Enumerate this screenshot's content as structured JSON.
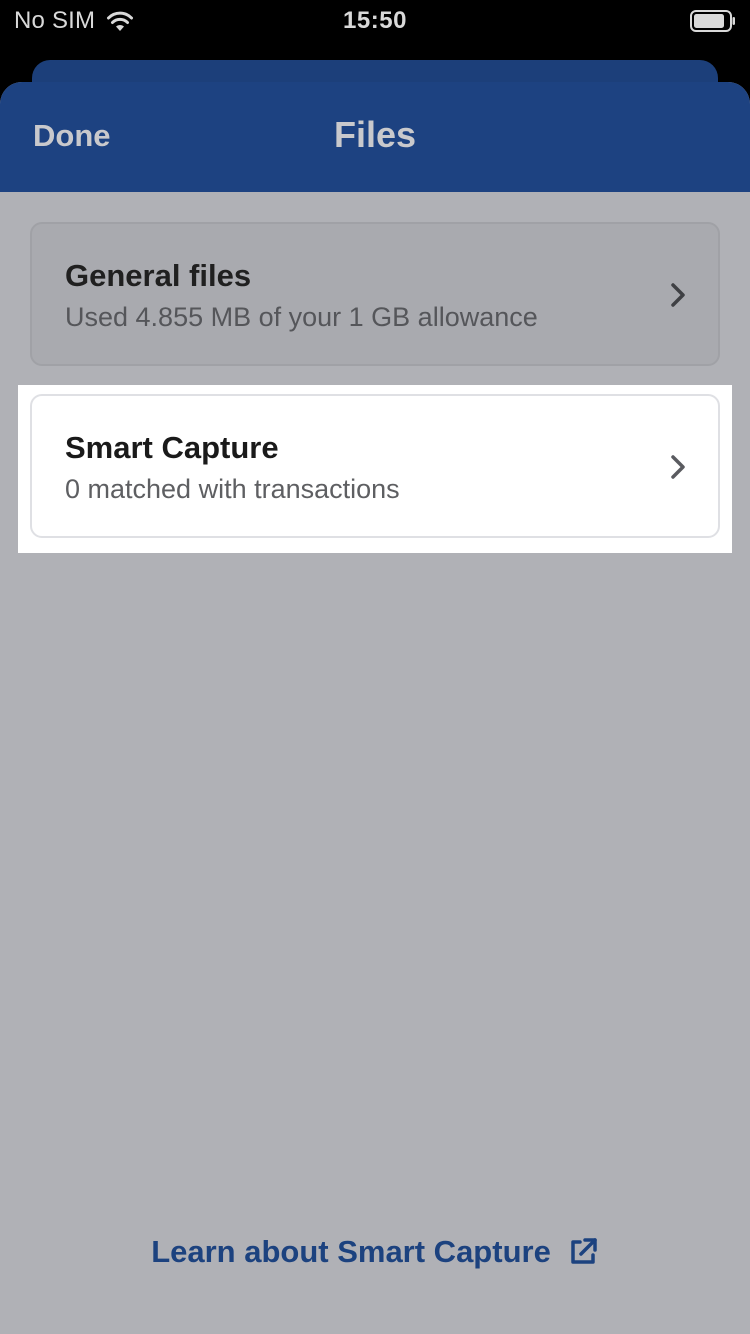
{
  "status_bar": {
    "carrier": "No SIM",
    "time": "15:50"
  },
  "nav": {
    "done_label": "Done",
    "title": "Files"
  },
  "list": [
    {
      "title": "General files",
      "subtitle": "Used 4.855 MB of your 1 GB allowance"
    },
    {
      "title": "Smart Capture",
      "subtitle": "0 matched with transactions"
    }
  ],
  "footer": {
    "link_label": "Learn about Smart Capture"
  },
  "colors": {
    "nav_blue": "#1d4281",
    "link_blue": "#1c427f",
    "overlay_grey": "#b0b1b6"
  },
  "icons": [
    "wifi-icon",
    "battery-icon",
    "chevron-right-icon",
    "external-link-icon"
  ]
}
